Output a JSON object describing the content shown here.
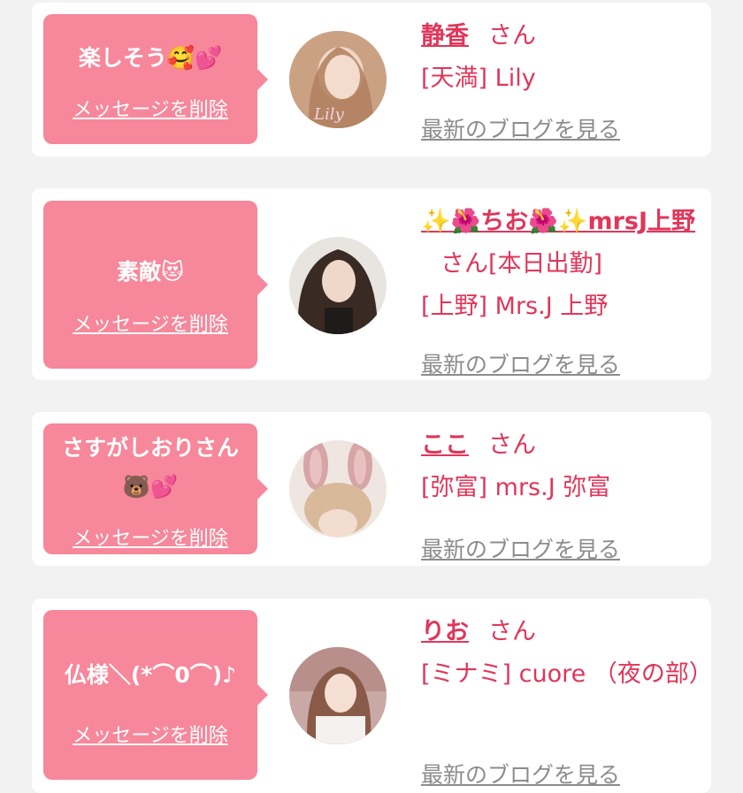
{
  "delete_label": "メッセージを削除",
  "blog_label": "最新のブログを見る",
  "san_label": "さん",
  "colors": {
    "bubble": "#f7879a",
    "accent": "#e0365a",
    "link_gray": "#8c8c8c",
    "background": "#f2f2f2"
  },
  "cards": [
    {
      "message": "楽しそう🥰💕",
      "name": "静香",
      "status": "",
      "shop": "[天満] Lily"
    },
    {
      "message": "素敵😻",
      "name": "✨🌺ちお🌺✨mrsJ上野",
      "status": "[本日出勤]",
      "shop": "[上野] Mrs.J 上野"
    },
    {
      "message": "さすがしおりさん🐻💕",
      "name": "ここ",
      "status": "",
      "shop": "[弥富] mrs.J 弥富"
    },
    {
      "message": "仏様＼(*⌒0⌒)♪",
      "name": "りお",
      "status": "",
      "shop": "[ミナミ] cuore （夜の部）"
    }
  ]
}
